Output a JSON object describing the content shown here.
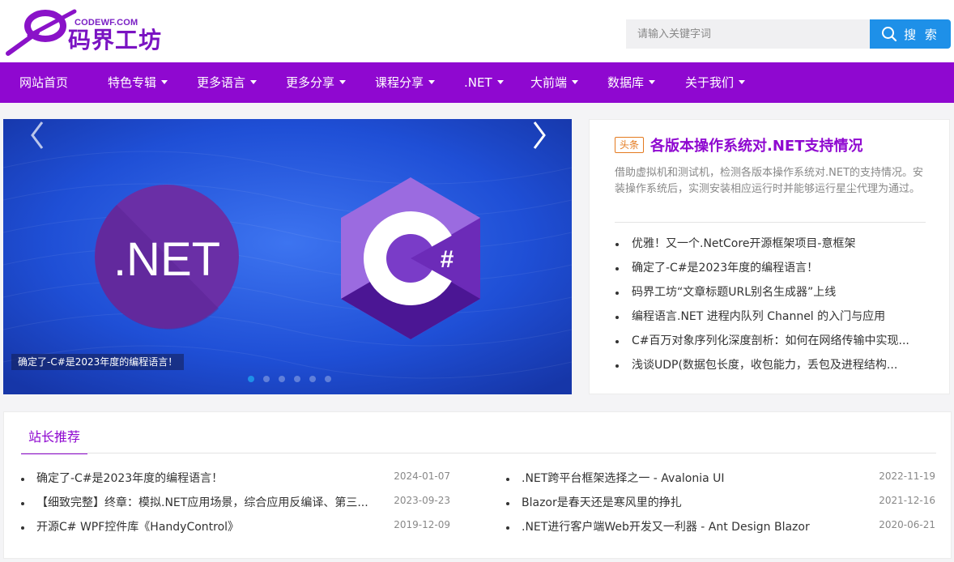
{
  "brand": {
    "domain": "CODEWF.COM",
    "name": "码界工坊"
  },
  "search": {
    "placeholder": "请输入关键字词",
    "value": "",
    "button_label": "搜 索"
  },
  "nav": {
    "items": [
      {
        "label": "网站首页",
        "has_dropdown": false
      },
      {
        "label": "特色专辑",
        "has_dropdown": true
      },
      {
        "label": "更多语言",
        "has_dropdown": true
      },
      {
        "label": "更多分享",
        "has_dropdown": true
      },
      {
        "label": "课程分享",
        "has_dropdown": true
      },
      {
        "label": ".NET",
        "has_dropdown": true
      },
      {
        "label": "大前端",
        "has_dropdown": true
      },
      {
        "label": "数据库",
        "has_dropdown": true
      },
      {
        "label": "关于我们",
        "has_dropdown": true
      }
    ]
  },
  "banner": {
    "net_logo_text": ".NET",
    "csharp_logo_text": "C#",
    "caption": "确定了-C#是2023年度的编程语言！",
    "slide_count": 6,
    "active_slide": 1
  },
  "headline": {
    "tag": "头条",
    "title": "各版本操作系统对.NET支持情况",
    "summary": "借助虚拟机和测试机，检测各版本操作系统对.NET的支持情况。安装操作系统后，实测安装相应运行时并能够运行星尘代理为通过。",
    "list": [
      "优雅！又一个.NetCore开源框架项目-意框架",
      "确定了-C#是2023年度的编程语言！",
      "码界工坊“文章标题URL别名生成器”上线",
      "编程语言.NET 进程内队列 Channel 的入门与应用",
      "C#百万对象序列化深度剖析：如何在网络传输中实现...",
      "浅谈UDP(数据包长度，收包能力，丢包及进程结构..."
    ]
  },
  "recommend": {
    "tab_label": "站长推荐",
    "left": [
      {
        "title": "确定了-C#是2023年度的编程语言！",
        "date": "2024-01-07"
      },
      {
        "title": "【细致完整】终章：模拟.NET应用场景，综合应用反编译、第三...",
        "date": "2023-09-23"
      },
      {
        "title": "开源C# WPF控件库《HandyControl》",
        "date": "2019-12-09"
      }
    ],
    "right": [
      {
        "title": ".NET跨平台框架选择之一 - Avalonia UI",
        "date": "2022-11-19"
      },
      {
        "title": "Blazor是春天还是寒风里的挣扎",
        "date": "2021-12-16"
      },
      {
        "title": ".NET进行客户端Web开发又一利器 - Ant Design Blazor",
        "date": "2020-06-21"
      }
    ]
  },
  "colors": {
    "brand_purple": "#8f08d0",
    "search_blue": "#1e90e8",
    "tag_orange": "#e47a1f",
    "banner_blue": "#1f4fd6"
  }
}
